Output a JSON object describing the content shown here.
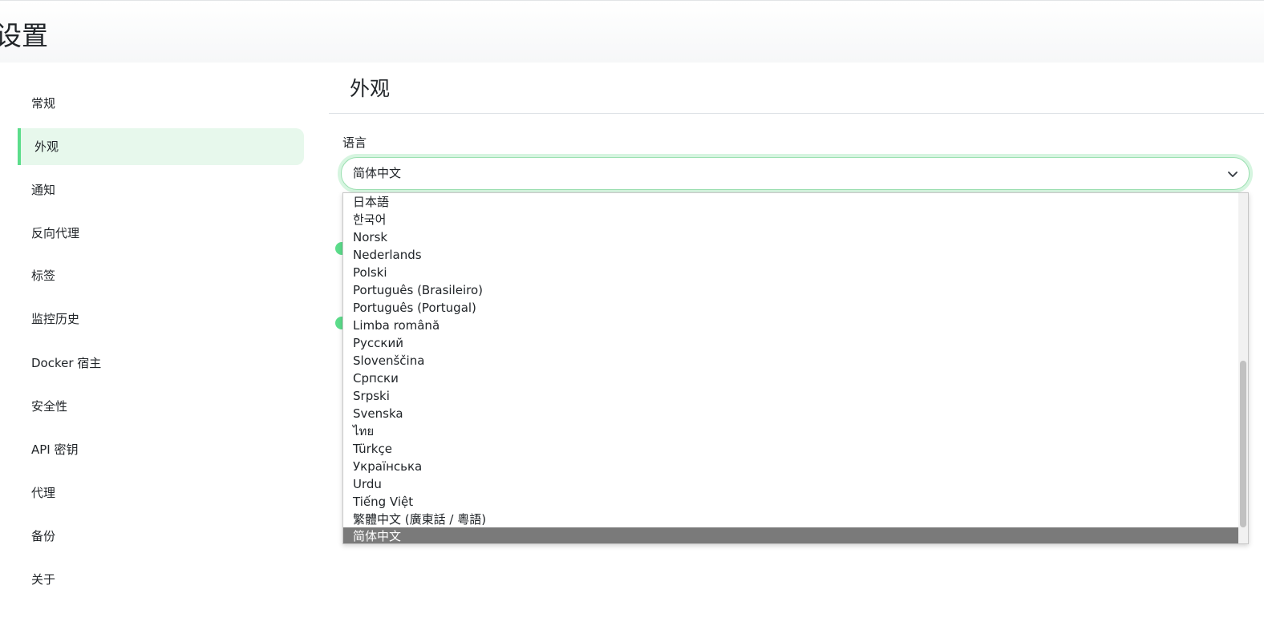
{
  "header": {
    "title": "设置"
  },
  "sidebar": {
    "items": [
      {
        "label": "常规"
      },
      {
        "label": "外观"
      },
      {
        "label": "通知"
      },
      {
        "label": "反向代理"
      },
      {
        "label": "标签"
      },
      {
        "label": "监控历史"
      },
      {
        "label": "Docker 宿主"
      },
      {
        "label": "安全性"
      },
      {
        "label": "API 密钥"
      },
      {
        "label": "代理"
      },
      {
        "label": "备份"
      },
      {
        "label": "关于"
      }
    ],
    "active_index": 1
  },
  "main": {
    "section_title": "外观",
    "language": {
      "label": "语言",
      "selected_value": "简体中文",
      "options": [
        "日本語",
        "한국어",
        "Norsk",
        "Nederlands",
        "Polski",
        "Português (Brasileiro)",
        "Português (Portugal)",
        "Limba română",
        "Русский",
        "Slovenščina",
        "Српски",
        "Srpski",
        "Svenska",
        "ไทย",
        "Türkçe",
        "Українська",
        "Urdu",
        "Tiếng Việt",
        "繁體中文 (廣東話 / 粵語)",
        "简体中文"
      ],
      "highlighted_option": "简体中文"
    }
  },
  "colors": {
    "accent": "#5cdd8b",
    "active_bg": "#e7f8ec",
    "option_highlight": "#7a7a7a"
  }
}
